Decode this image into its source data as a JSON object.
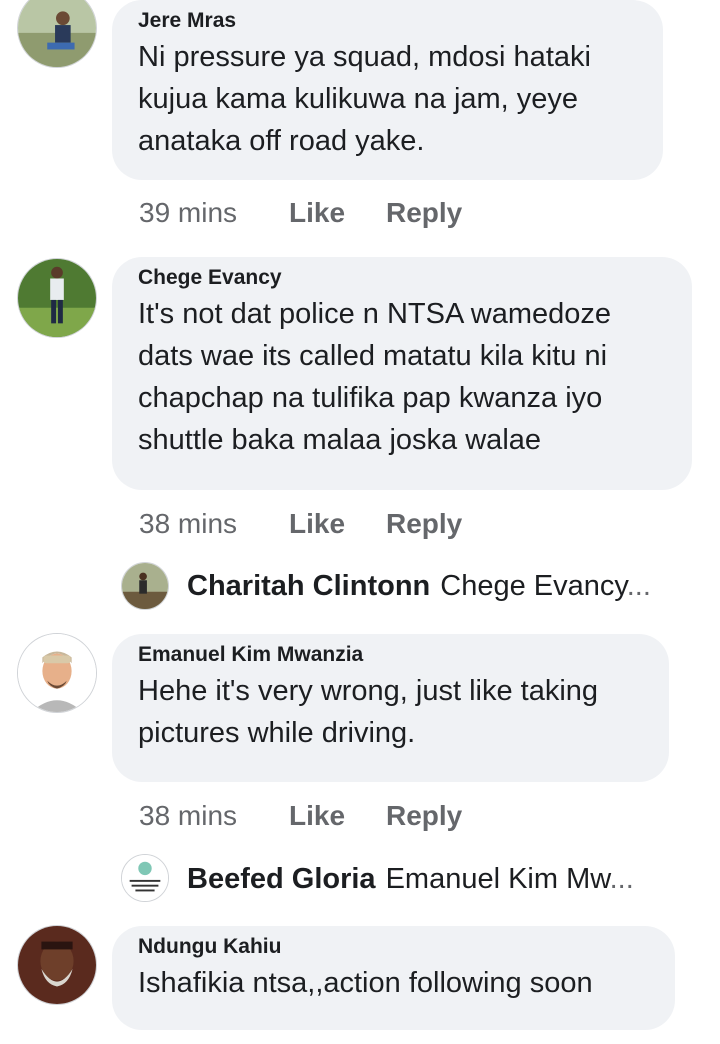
{
  "comments": [
    {
      "author": "Jere Mras",
      "text": "Ni pressure ya squad, mdosi hataki kujua kama kulikuwa na jam, yeye anataka off road yake.",
      "time": "39 mins",
      "like": "Like",
      "reply": "Reply"
    },
    {
      "author": "Chege Evancy",
      "text": "It's not dat police n NTSA wamedoze dats wae its called matatu kila kitu ni chapchap na tulifika pap kwanza iyo shuttle baka malaa joska walae",
      "time": "38 mins",
      "like": "Like",
      "reply": "Reply",
      "sub_reply": {
        "author": "Charitah Clintonn",
        "preview": "Chege Evancy",
        "ellipsis": "..."
      }
    },
    {
      "author": "Emanuel Kim Mwanzia",
      "text": "Hehe it's very wrong, just like taking pictures while driving.",
      "time": "38 mins",
      "like": "Like",
      "reply": "Reply",
      "sub_reply": {
        "author": "Beefed Gloria",
        "preview": "Emanuel Kim Mw",
        "ellipsis": "..."
      }
    },
    {
      "author": "Ndungu Kahiu",
      "text": "Ishafikia ntsa,,action following soon"
    }
  ],
  "colors": {
    "bubble": "#f0f2f5",
    "meta_text": "#65676b",
    "primary_text": "#1c1e21"
  },
  "icons": {
    "avatar": "profile-photo",
    "sub_avatar": "profile-photo-small"
  }
}
